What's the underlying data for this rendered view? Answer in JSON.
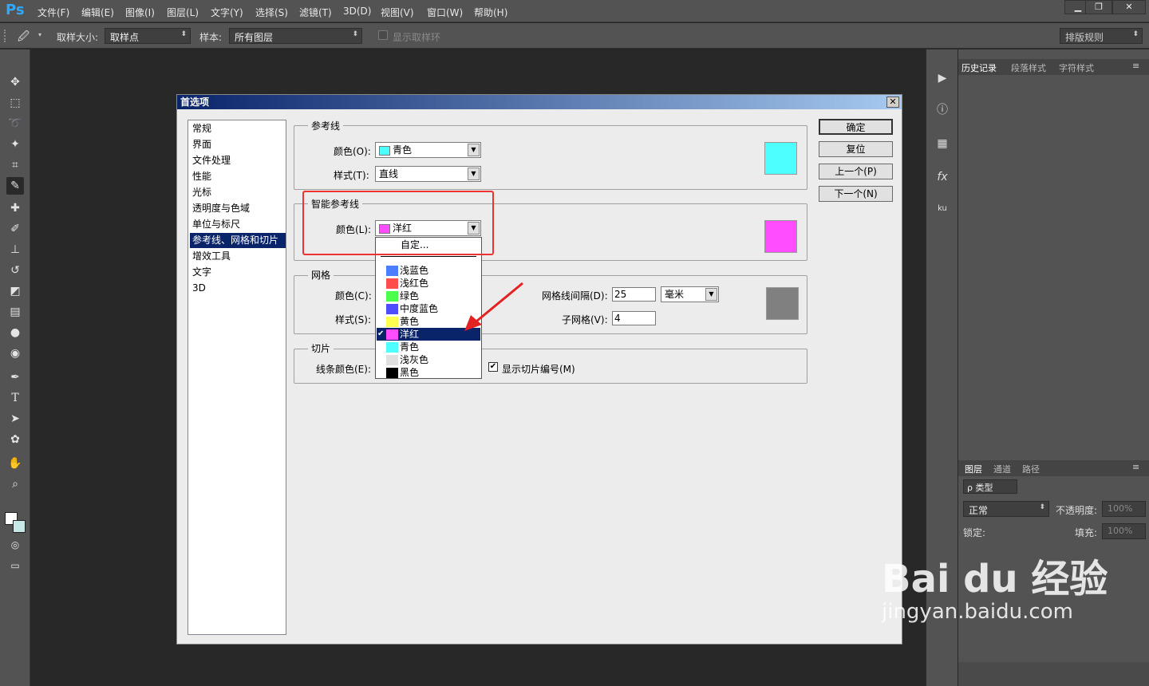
{
  "app": {
    "logo": "Ps"
  },
  "menu": [
    "文件(F)",
    "编辑(E)",
    "图像(I)",
    "图层(L)",
    "文字(Y)",
    "选择(S)",
    "滤镜(T)",
    "3D(D)",
    "视图(V)",
    "窗口(W)",
    "帮助(H)"
  ],
  "window_controls": {
    "minimize": "▁",
    "restore": "❐",
    "close": "✕"
  },
  "options": {
    "sample_size_label": "取样大小:",
    "sample_size_value": "取样点",
    "sample_label": "样本:",
    "sample_value": "所有图层",
    "show_ring_label": "显示取样环",
    "workspace": "排版规则"
  },
  "tools": [
    "move-icon",
    "marquee-icon",
    "lasso-icon",
    "magic-wand-icon",
    "crop-icon",
    "eyedropper-icon",
    "healing-icon",
    "brush-icon",
    "stamp-icon",
    "history-brush-icon",
    "eraser-icon",
    "gradient-icon",
    "blur-icon",
    "dodge-icon",
    "pen-icon",
    "type-icon",
    "path-select-icon",
    "shape-icon",
    "hand-icon",
    "zoom-icon"
  ],
  "right_panel": {
    "tabs_top": [
      "历史记录",
      "段落样式",
      "字符样式"
    ],
    "tabs_bottom": [
      "图层",
      "通道",
      "路径"
    ],
    "kind_label": "ρ 类型",
    "blend_mode": "正常",
    "opacity_label": "不透明度:",
    "opacity_value": "100%",
    "lock_label": "锁定:",
    "fill_label": "填充:",
    "fill_value": "100%"
  },
  "dialog": {
    "title": "首选项",
    "close": "✕",
    "categories": [
      "常规",
      "界面",
      "文件处理",
      "性能",
      "光标",
      "透明度与色域",
      "单位与标尺",
      "参考线、网格和切片",
      "增效工具",
      "文字",
      "3D"
    ],
    "selected_category_index": 7,
    "buttons": {
      "ok": "确定",
      "reset": "复位",
      "prev": "上一个(P)",
      "next": "下一个(N)"
    },
    "guides": {
      "title": "参考线",
      "color_label": "颜色(O):",
      "color_value": "青色",
      "color_hex": "#4dffff",
      "style_label": "样式(T):",
      "style_value": "直线"
    },
    "smart_guides": {
      "title": "智能参考线",
      "color_label": "颜色(L):",
      "color_value": "洋红",
      "color_hex": "#ff4dff"
    },
    "grid": {
      "title": "网格",
      "color_label": "颜色(C):",
      "style_label": "样式(S):",
      "spacing_label": "网格线间隔(D):",
      "spacing_value": "25",
      "unit_value": "毫米",
      "subdiv_label": "子网格(V):",
      "subdiv_value": "4",
      "color_hex": "#808080"
    },
    "slices": {
      "title": "切片",
      "line_color_label": "线条颜色(E):",
      "show_numbers_label": "显示切片编号(M)",
      "show_numbers_checked": true
    },
    "dropdown": {
      "custom": "自定...",
      "options": [
        {
          "label": "浅蓝色",
          "color": "#4a7dff"
        },
        {
          "label": "浅红色",
          "color": "#ff4d4d"
        },
        {
          "label": "绿色",
          "color": "#4dff4d"
        },
        {
          "label": "中度蓝色",
          "color": "#4d4dff"
        },
        {
          "label": "黄色",
          "color": "#ffff4d"
        },
        {
          "label": "洋红",
          "color": "#ff4dff"
        },
        {
          "label": "青色",
          "color": "#4dffff"
        },
        {
          "label": "浅灰色",
          "color": "#e0e0e0"
        },
        {
          "label": "黑色",
          "color": "#000000"
        }
      ],
      "selected_index": 5,
      "check": "✔"
    }
  },
  "watermark": {
    "brand": "Bai du 经验",
    "url": "jingyan.baidu.com"
  }
}
